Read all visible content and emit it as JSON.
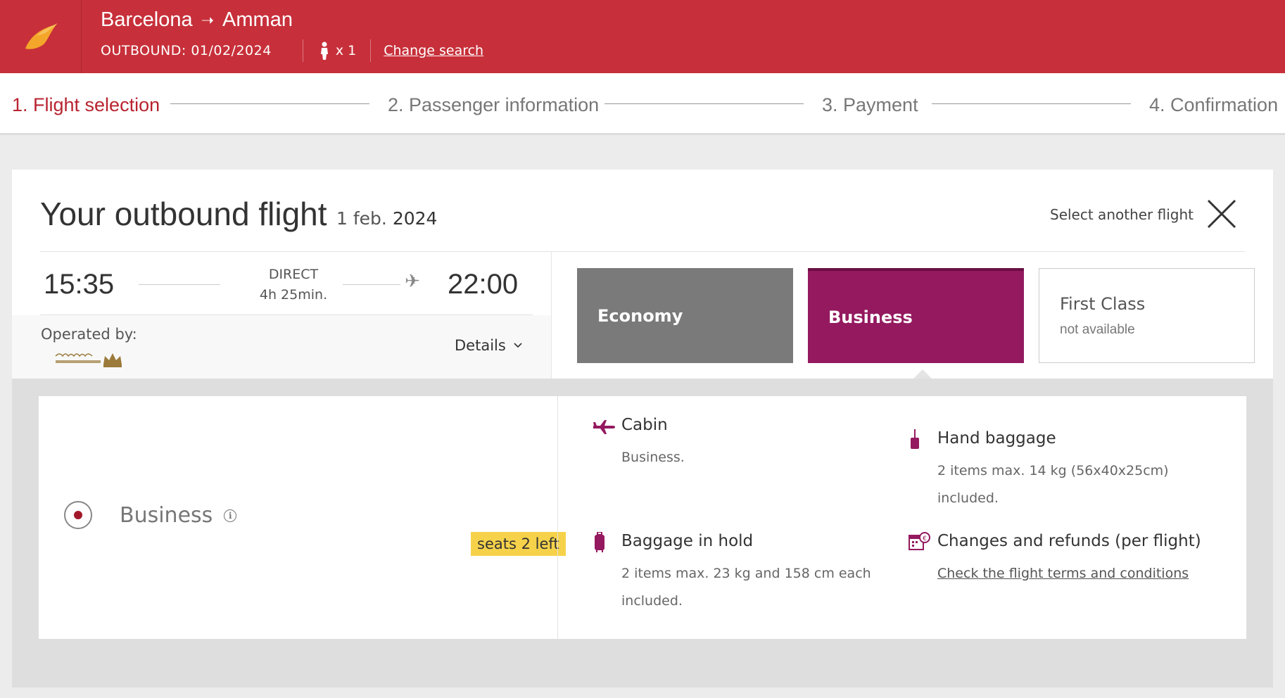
{
  "header": {
    "origin": "Barcelona",
    "destination": "Amman",
    "outbound": "OUTBOUND: 01/02/2024",
    "passengers": "x 1",
    "change_search": "Change search",
    "brand_color": "#c7303a"
  },
  "steps": [
    {
      "label": "1. Flight selection",
      "active": true
    },
    {
      "label": "2. Passenger information",
      "active": false
    },
    {
      "label": "3. Payment",
      "active": false
    },
    {
      "label": "4. Confirmation",
      "active": false
    }
  ],
  "card": {
    "title": "Your outbound flight",
    "date_day": "1 feb.",
    "date_year": "2024",
    "select_another": "Select another flight"
  },
  "flight": {
    "departure": "15:35",
    "arrival": "22:00",
    "type": "DIRECT",
    "duration": "4h 25min.",
    "operated_by": "Operated by:",
    "operator_logo": "royal-jordanian-logo",
    "details": "Details"
  },
  "fares": {
    "economy": {
      "label": "Economy",
      "color": "#7a7a7a"
    },
    "business": {
      "label": "Business",
      "color": "#94195f",
      "selected": true
    },
    "first": {
      "label": "First Class",
      "status": "not available"
    }
  },
  "fare_detail": {
    "name": "Business",
    "seats": "seats 2 left",
    "features": {
      "cabin": {
        "title": "Cabin",
        "lines": [
          "Business."
        ]
      },
      "hand": {
        "title": "Hand baggage",
        "lines": [
          "2 items max. 14 kg (56x40x25cm)",
          "included."
        ]
      },
      "hold": {
        "title": "Baggage in hold",
        "lines": [
          "2 items max. 23 kg and 158 cm each",
          "included."
        ]
      },
      "changes": {
        "title": "Changes and refunds (per flight)",
        "link": "Check the flight terms and conditions"
      }
    }
  }
}
